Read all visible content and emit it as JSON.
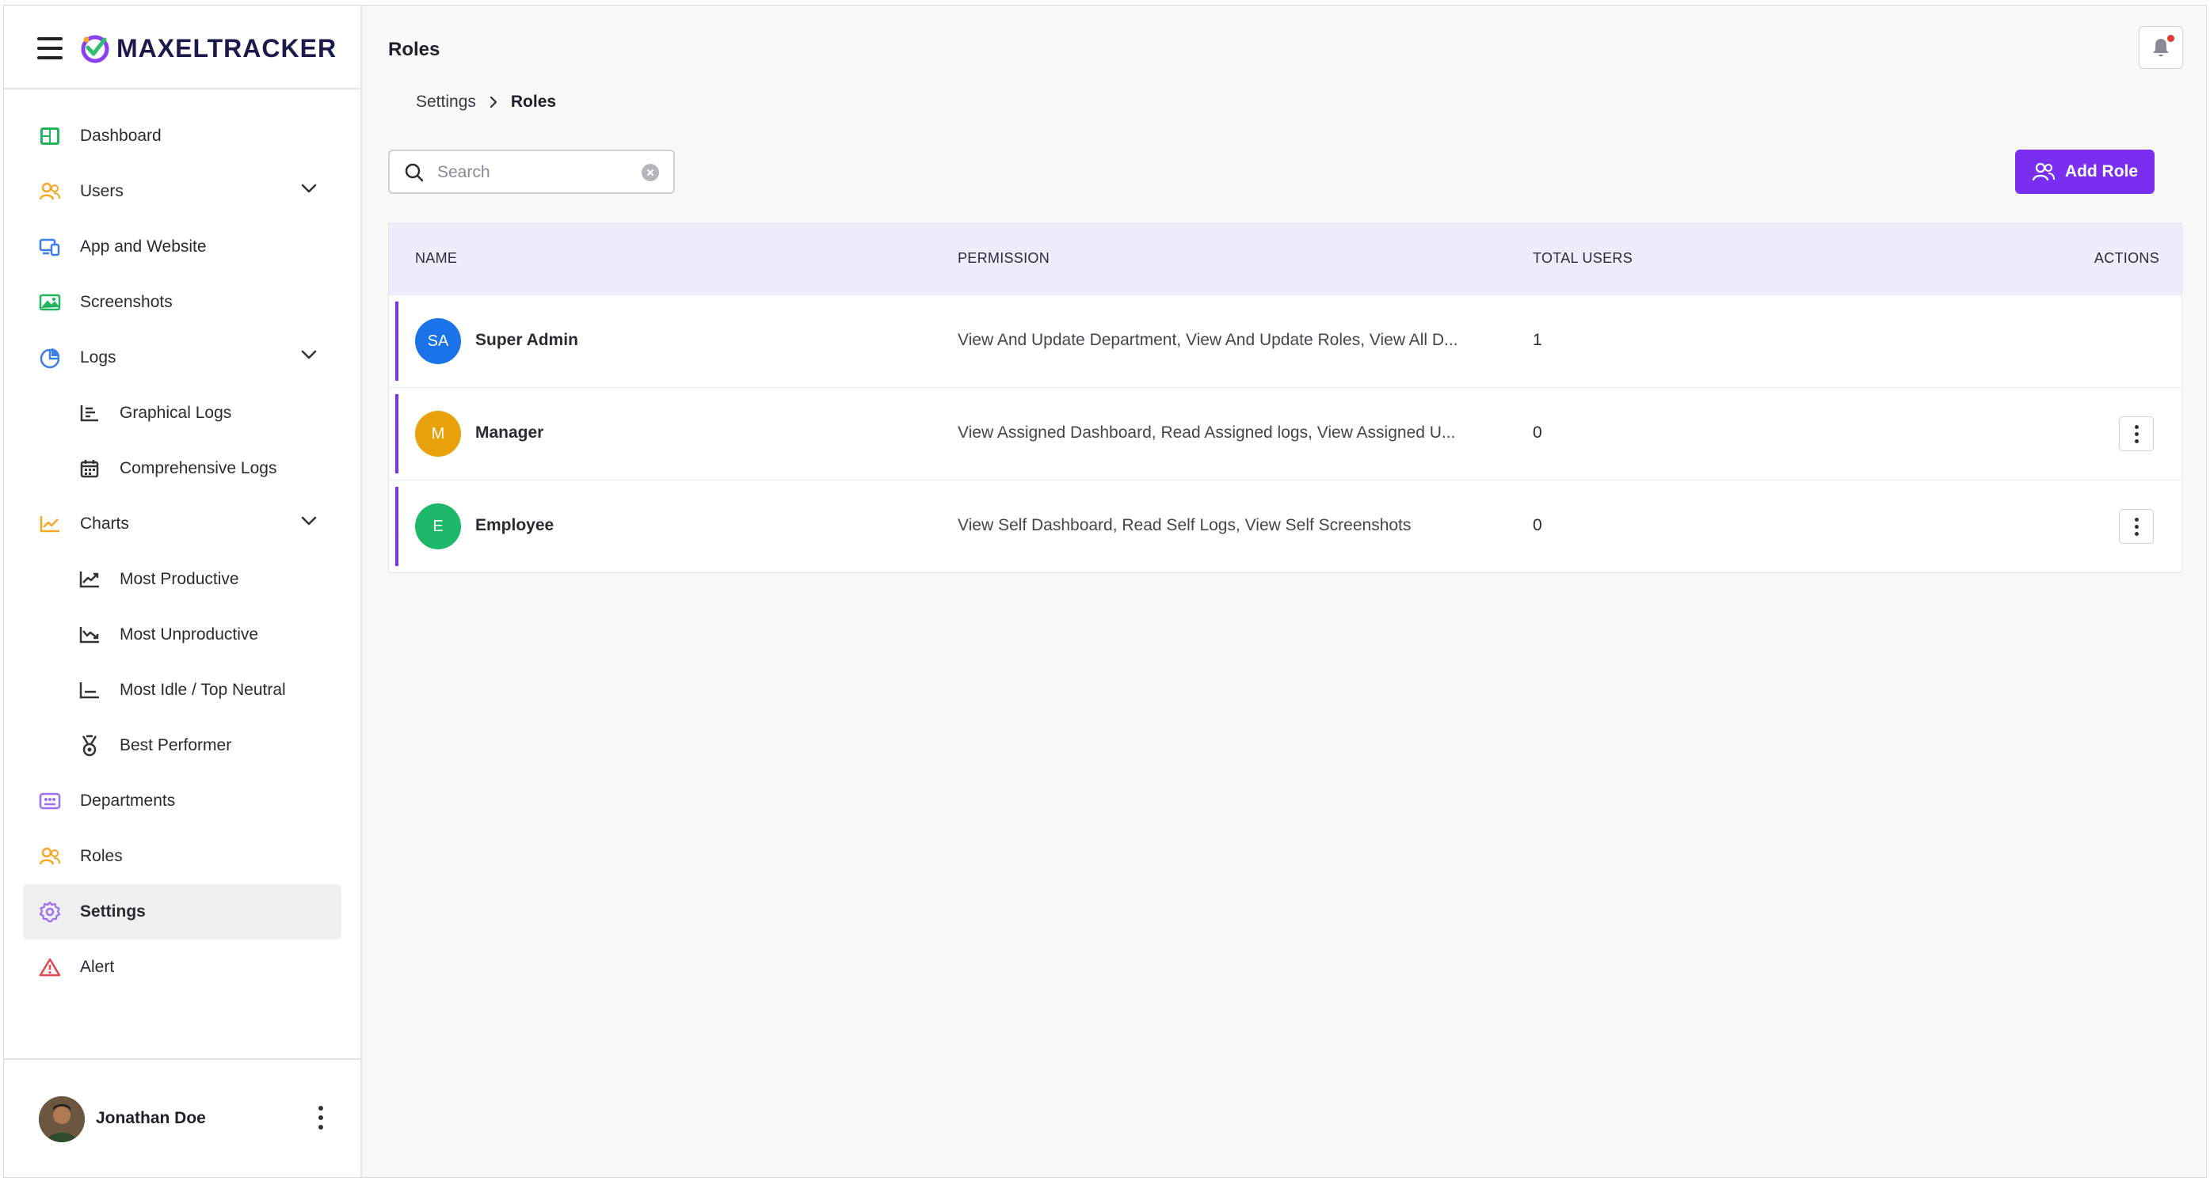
{
  "app": {
    "logo_text": "MAXELTRACKER"
  },
  "sidebar": {
    "items": [
      {
        "label": "Dashboard"
      },
      {
        "label": "Users"
      },
      {
        "label": "App and Website"
      },
      {
        "label": "Screenshots"
      },
      {
        "label": "Logs"
      },
      {
        "label": "Graphical Logs"
      },
      {
        "label": "Comprehensive Logs"
      },
      {
        "label": "Charts"
      },
      {
        "label": "Most Productive"
      },
      {
        "label": "Most Unproductive"
      },
      {
        "label": "Most Idle / Top Neutral"
      },
      {
        "label": "Best Performer"
      },
      {
        "label": "Departments"
      },
      {
        "label": "Roles"
      },
      {
        "label": "Settings"
      },
      {
        "label": "Alert"
      }
    ],
    "user": {
      "name": "Jonathan Doe"
    }
  },
  "header": {
    "title": "Roles"
  },
  "breadcrumb": {
    "parent": "Settings",
    "current": "Roles"
  },
  "search": {
    "placeholder": "Search",
    "value": ""
  },
  "toolbar": {
    "add_label": "Add Role"
  },
  "table": {
    "columns": {
      "name": "NAME",
      "permission": "PERMISSION",
      "total": "TOTAL USERS",
      "actions": "ACTIONS"
    },
    "rows": [
      {
        "initials": "SA",
        "name": "Super Admin",
        "permission": "View And Update Department, View And Update Roles, View All D...",
        "total": "1",
        "color": "#1a73e8"
      },
      {
        "initials": "M",
        "name": "Manager",
        "permission": "View Assigned Dashboard, Read Assigned logs, View Assigned U...",
        "total": "0",
        "color": "#e8a10a"
      },
      {
        "initials": "E",
        "name": "Employee",
        "permission": "View Self Dashboard, Read Self Logs, View Self Screenshots",
        "total": "0",
        "color": "#1db86a"
      }
    ]
  },
  "colors": {
    "accent": "#7a2ff0",
    "header_bg": "#eeebfb",
    "notification": "#e53935"
  }
}
